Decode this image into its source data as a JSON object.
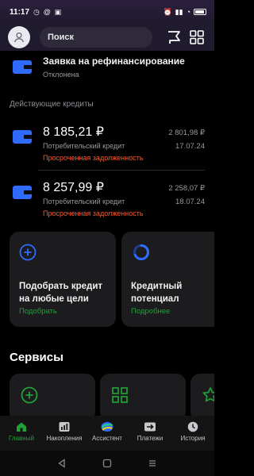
{
  "status_bar": {
    "time": "11:17",
    "battery": "100"
  },
  "header": {
    "search_placeholder": "Поиск"
  },
  "refinance": {
    "title": "Заявка на рефинансирование",
    "status": "Отклонена"
  },
  "loans_section": {
    "label": "Действующие кредиты"
  },
  "loans": [
    {
      "amount": "8 185,21 ₽",
      "type": "Потребительский кредит",
      "warning": "Просроченная задолженность",
      "payment": "2 801,98 ₽",
      "date": "17.07.24"
    },
    {
      "amount": "8 257,99 ₽",
      "type": "Потребительский кредит",
      "warning": "Просроченная задолженность",
      "payment": "2 258,07 ₽",
      "date": "18.07.24"
    }
  ],
  "tiles": [
    {
      "title_line1": "Подобрать кредит",
      "title_line2": "на любые цели",
      "link": "Подобрать"
    },
    {
      "title_line1": "Кредитный",
      "title_line2": "потенциал",
      "link": "Подробнее"
    }
  ],
  "services": {
    "title": "Сервисы"
  },
  "bottom_nav": [
    {
      "label": "Главный"
    },
    {
      "label": "Накопления"
    },
    {
      "label": "Ассистент"
    },
    {
      "label": "Платежи"
    },
    {
      "label": "История"
    }
  ],
  "colors": {
    "accent": "#21a038",
    "warning": "#ff5a2e",
    "card_blue": "#2f6bff",
    "tile_bg": "#1c1c1f"
  }
}
